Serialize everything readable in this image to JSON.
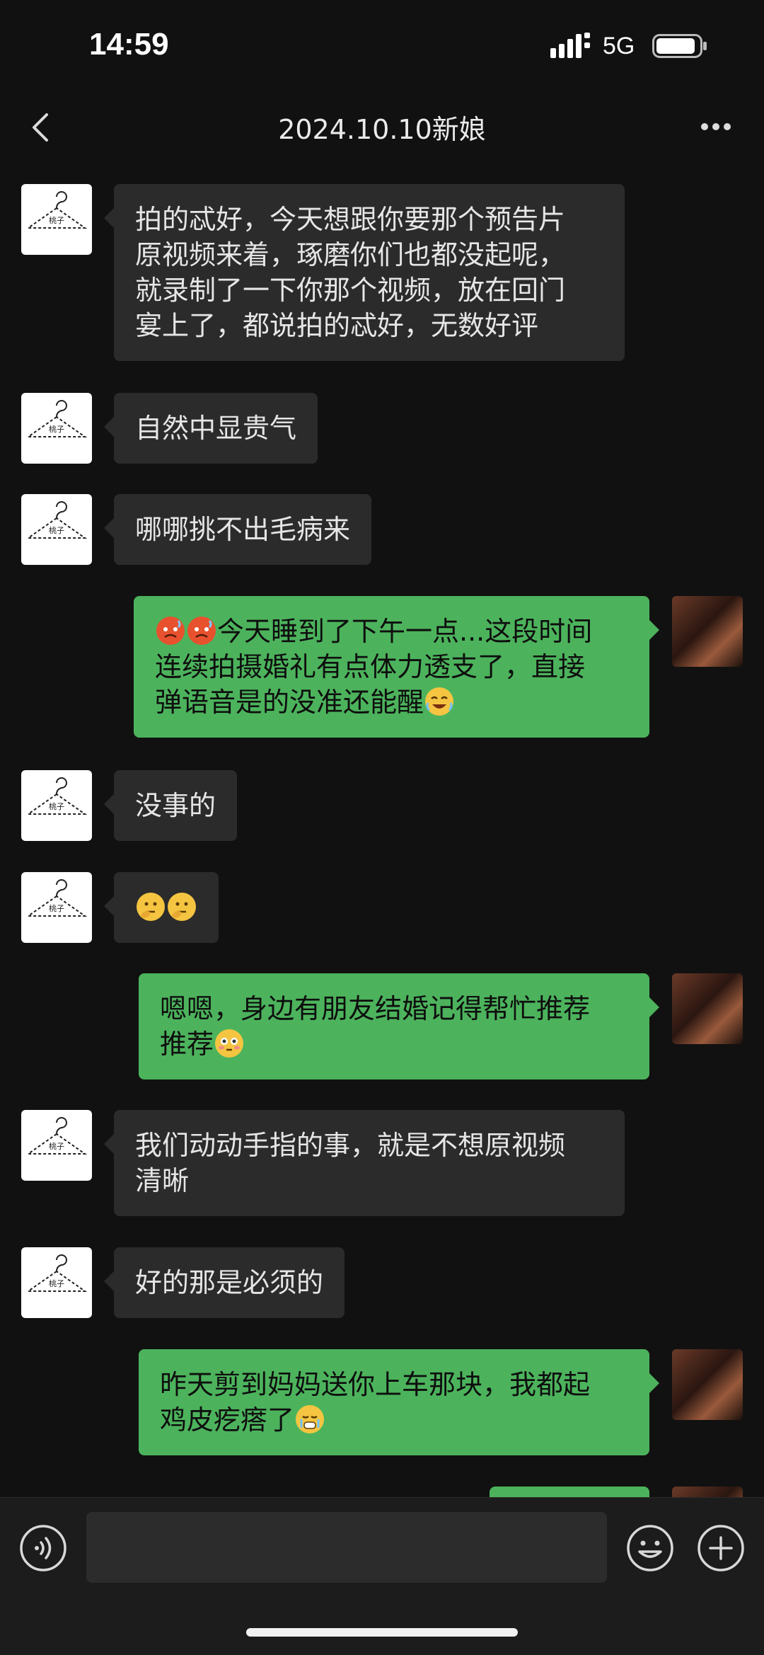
{
  "status_bar": {
    "time": "14:59",
    "network": "5G"
  },
  "header": {
    "title": "2024.10.10新娘"
  },
  "messages": [
    {
      "side": "in",
      "lines": [
        "拍的忒好，今天想跟你要那个预告片",
        "原视频来着，琢磨你们也都没起呢，",
        "就录制了一下你那个视频，放在回门",
        "宴上了，都说拍的忒好，无数好评"
      ]
    },
    {
      "side": "in",
      "lines": [
        "自然中显贵气"
      ]
    },
    {
      "side": "in",
      "lines": [
        "哪哪挑不出毛病来"
      ]
    },
    {
      "side": "out",
      "lines": [
        "今天睡到了下午一点...这段时间",
        "连续拍摄婚礼有点体力透支了，直接",
        "弹语音是的没准还能醒"
      ],
      "emojis": [
        "hot-face-emoji",
        "hot-face-emoji",
        "laughing-tears-emoji"
      ]
    },
    {
      "side": "in",
      "lines": [
        "没事的"
      ]
    },
    {
      "side": "in",
      "emojis": [
        "thinking-face-emoji",
        "thinking-face-emoji"
      ]
    },
    {
      "side": "out",
      "lines": [
        "嗯嗯，身边有朋友结婚记得帮忙推荐",
        "推荐"
      ],
      "emojis": [
        "flushed-face-emoji"
      ]
    },
    {
      "side": "in",
      "lines": [
        "我们动动手指的事，就是不想原视频",
        "清晰"
      ]
    },
    {
      "side": "in",
      "lines": [
        "好的那是必须的"
      ]
    },
    {
      "side": "out",
      "lines": [
        "昨天剪到妈妈送你上车那块，我都起",
        "鸡皮疙瘩了"
      ],
      "emojis": [
        "crying-face-emoji"
      ]
    }
  ],
  "colors": {
    "incoming_bubble": "#2b2b2b",
    "outgoing_bubble": "#4cb35c",
    "background": "#111111"
  },
  "icons": [
    "back-chevron-icon",
    "more-dots-icon",
    "voice-icon",
    "emoji-icon",
    "plus-icon",
    "signal-icon",
    "battery-icon",
    "hanger-logo-icon"
  ]
}
